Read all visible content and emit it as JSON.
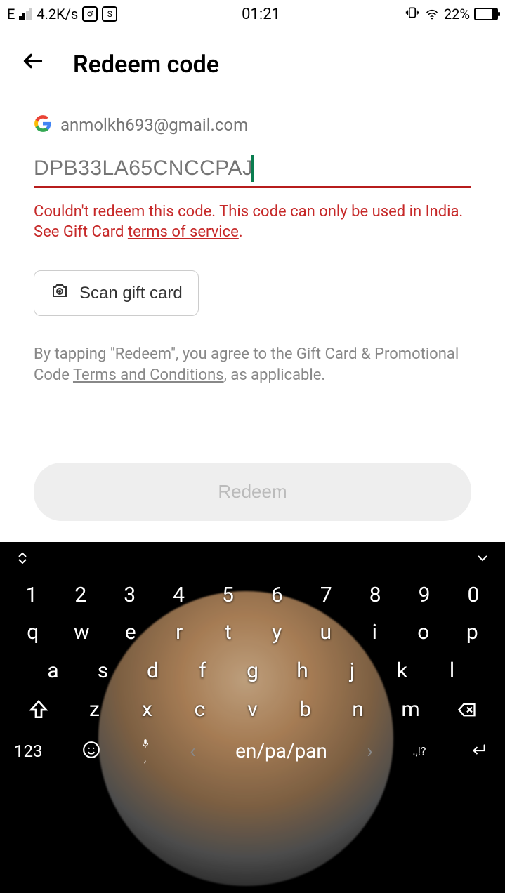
{
  "status": {
    "network": "E",
    "speed": "4.2K/s",
    "time": "01:21",
    "battery_pct": "22%"
  },
  "header": {
    "title": "Redeem code"
  },
  "account": {
    "email": "anmolkh693@gmail.com"
  },
  "code": {
    "value": "DPB33LA65CNCCPAJ"
  },
  "error": {
    "prefix": "Couldn't redeem this code. This code can only be used in India. See Gift Card ",
    "link": "terms of service",
    "suffix": "."
  },
  "scan": {
    "label": "Scan gift card"
  },
  "terms": {
    "prefix": "By tapping \"Redeem\", you agree to the Gift Card & Promotional Code ",
    "link": "Terms and Conditions",
    "suffix": ", as applicable."
  },
  "redeem": {
    "label": "Redeem"
  },
  "keyboard": {
    "row_num": [
      "1",
      "2",
      "3",
      "4",
      "5",
      "6",
      "7",
      "8",
      "9",
      "0"
    ],
    "row1": [
      "q",
      "w",
      "e",
      "r",
      "t",
      "y",
      "u",
      "i",
      "o",
      "p"
    ],
    "row2": [
      "a",
      "s",
      "d",
      "f",
      "g",
      "h",
      "j",
      "k",
      "l"
    ],
    "row3": [
      "z",
      "x",
      "c",
      "v",
      "b",
      "n",
      "m"
    ],
    "mode": "123",
    "lang": "en/pa/pan",
    "punct": ".,!?",
    "comma": ","
  }
}
